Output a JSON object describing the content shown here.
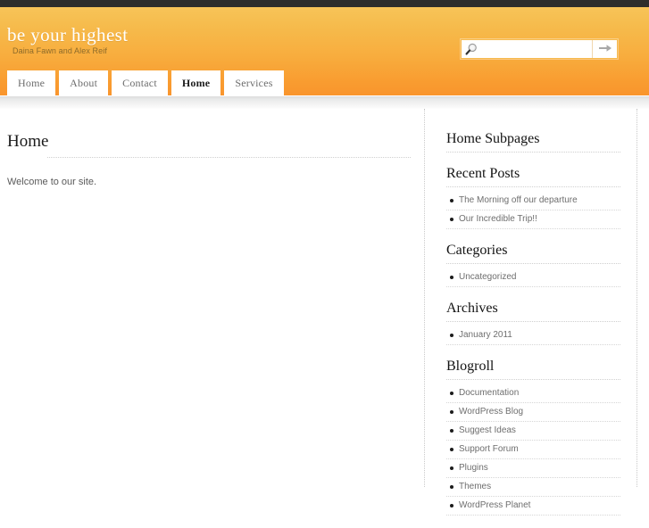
{
  "topbar": {
    "color": "#2d2d2b"
  },
  "header": {
    "site_title": "be your highest",
    "tagline": "Daina Fawn and Alex Reif",
    "gradient_top": "#f7c458",
    "gradient_bottom": "#f9952d"
  },
  "search": {
    "placeholder": "",
    "value": "",
    "icon": "search-icon",
    "submit_icon": "arrow-right-icon"
  },
  "nav": {
    "items": [
      {
        "label": "Home",
        "active": false
      },
      {
        "label": "About",
        "active": false
      },
      {
        "label": "Contact",
        "active": false
      },
      {
        "label": "Home",
        "active": true
      },
      {
        "label": "Services",
        "active": false
      }
    ]
  },
  "content": {
    "title": "Home",
    "body": "Welcome to our site."
  },
  "sidebar": {
    "widgets": [
      {
        "title": "Home Subpages",
        "items": []
      },
      {
        "title": "Recent Posts",
        "items": [
          "The Morning off our departure",
          "Our Incredible Trip!!"
        ]
      },
      {
        "title": "Categories",
        "items": [
          "Uncategorized"
        ]
      },
      {
        "title": "Archives",
        "items": [
          "January 2011"
        ]
      },
      {
        "title": "Blogroll",
        "items": [
          "Documentation",
          "WordPress Blog",
          "Suggest Ideas",
          "Support Forum",
          "Plugins",
          "Themes",
          "WordPress Planet"
        ]
      }
    ]
  }
}
